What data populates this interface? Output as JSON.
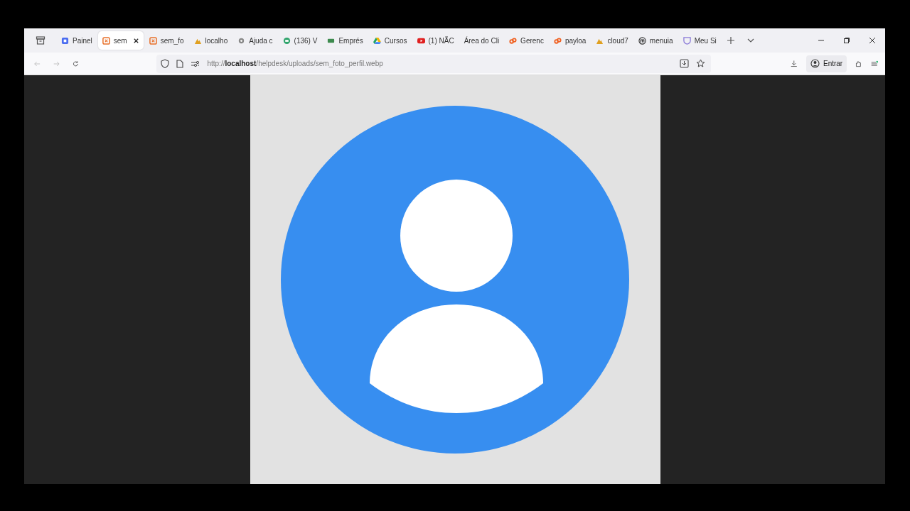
{
  "tabs": [
    {
      "label": "Painel",
      "selected": false,
      "kind": "square"
    },
    {
      "label": "sem",
      "selected": true,
      "kind": "box"
    },
    {
      "label": "sem_fo",
      "selected": false,
      "kind": "box"
    },
    {
      "label": "localho",
      "selected": false,
      "kind": "mountain"
    },
    {
      "label": "Ajuda c",
      "selected": false,
      "kind": "gear"
    },
    {
      "label": "(136) V",
      "selected": false,
      "kind": "chat"
    },
    {
      "label": "Emprés",
      "selected": false,
      "kind": "card"
    },
    {
      "label": "Cursos",
      "selected": false,
      "kind": "drive"
    },
    {
      "label": "(1) NÃC",
      "selected": false,
      "kind": "video"
    },
    {
      "label": "Área do Cli",
      "selected": false,
      "kind": "none"
    },
    {
      "label": "Gerenc",
      "selected": false,
      "kind": "link"
    },
    {
      "label": "payloa",
      "selected": false,
      "kind": "link"
    },
    {
      "label": "cloud7",
      "selected": false,
      "kind": "mountain"
    },
    {
      "label": "menuia",
      "selected": false,
      "kind": "m"
    },
    {
      "label": "Meu Si",
      "selected": false,
      "kind": "shield"
    }
  ],
  "address": {
    "url": "http://**localhost**/helpdesk/uploads/sem_foto_perfil.webp"
  },
  "account_button": {
    "label": "Entrar"
  }
}
